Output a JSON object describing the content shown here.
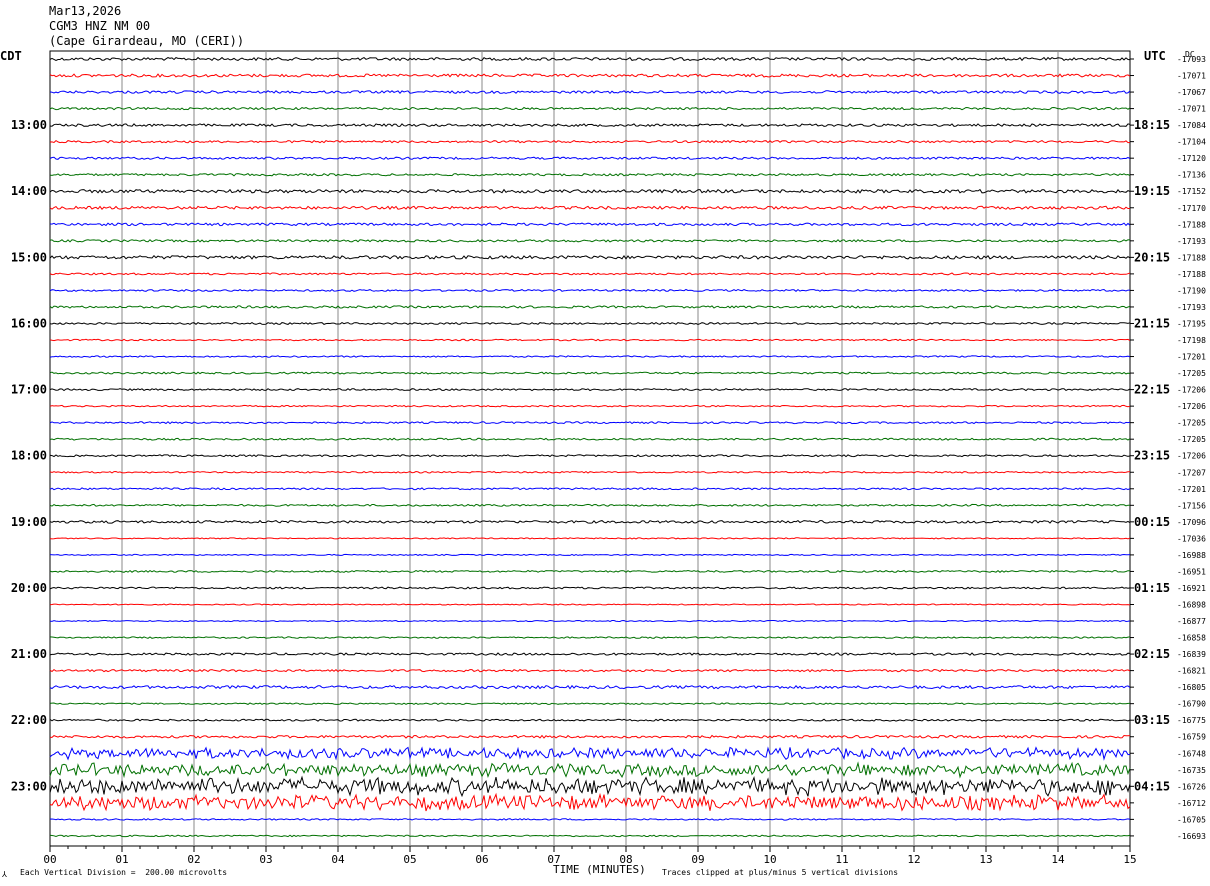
{
  "header": {
    "date": "Mar13,2026",
    "station": "CGM3 HNZ NM 00",
    "location": "(Cape Girardeau, MO (CERI))"
  },
  "chart_data": {
    "type": "line",
    "left_axis_title": "CDT",
    "right_axis_title": "UTC",
    "right_column_title": "DC",
    "xlabel": "TIME (MINUTES)",
    "xlim": [
      0,
      15
    ],
    "x_ticks": [
      "00",
      "01",
      "02",
      "03",
      "04",
      "05",
      "06",
      "07",
      "08",
      "09",
      "10",
      "11",
      "12",
      "13",
      "14",
      "15"
    ],
    "left_hour_labels": [
      "13:00",
      "14:00",
      "15:00",
      "16:00",
      "17:00",
      "18:00",
      "19:00",
      "20:00",
      "21:00",
      "22:00",
      "23:00"
    ],
    "right_hour_labels": [
      "18:15",
      "19:15",
      "20:15",
      "21:15",
      "22:15",
      "23:15",
      "00:15",
      "01:15",
      "02:15",
      "03:15",
      "04:15"
    ],
    "trace_colors": [
      "#000000",
      "#ff0000",
      "#0000ff",
      "#007000"
    ],
    "dc_offsets": [
      "-17093",
      "-17071",
      "-17067",
      "-17071",
      "-17084",
      "-17104",
      "-17120",
      "-17136",
      "-17152",
      "-17170",
      "-17188",
      "-17193",
      "-17188",
      "-17188",
      "-17190",
      "-17193",
      "-17195",
      "-17198",
      "-17201",
      "-17205",
      "-17206",
      "-17206",
      "-17205",
      "-17205",
      "-17206",
      "-17207",
      "-17201",
      "-17156",
      "-17096",
      "-17036",
      "-16988",
      "-16951",
      "-16921",
      "-16898",
      "-16877",
      "-16858",
      "-16839",
      "-16821",
      "-16805",
      "-16790",
      "-16775",
      "-16759",
      "-16748",
      "-16735",
      "-16726",
      "-16712",
      "-16705",
      "-16693"
    ],
    "trace_noise": [
      0.8,
      0.8,
      0.7,
      0.6,
      0.7,
      0.6,
      0.6,
      0.6,
      0.9,
      0.8,
      0.7,
      0.6,
      0.9,
      0.5,
      0.5,
      0.6,
      0.5,
      0.4,
      0.4,
      0.5,
      0.5,
      0.4,
      0.5,
      0.5,
      0.5,
      0.4,
      0.5,
      0.5,
      0.7,
      0.3,
      0.3,
      0.5,
      0.5,
      0.3,
      0.3,
      0.4,
      0.6,
      0.6,
      0.8,
      0.4,
      0.5,
      0.7,
      2.5,
      3.0,
      4.0,
      3.5,
      0.4,
      0.4
    ],
    "footer_left": "Each Vertical Division =  200.00 microvolts",
    "footer_right": "Traces clipped at plus/minus 5 vertical divisions"
  }
}
